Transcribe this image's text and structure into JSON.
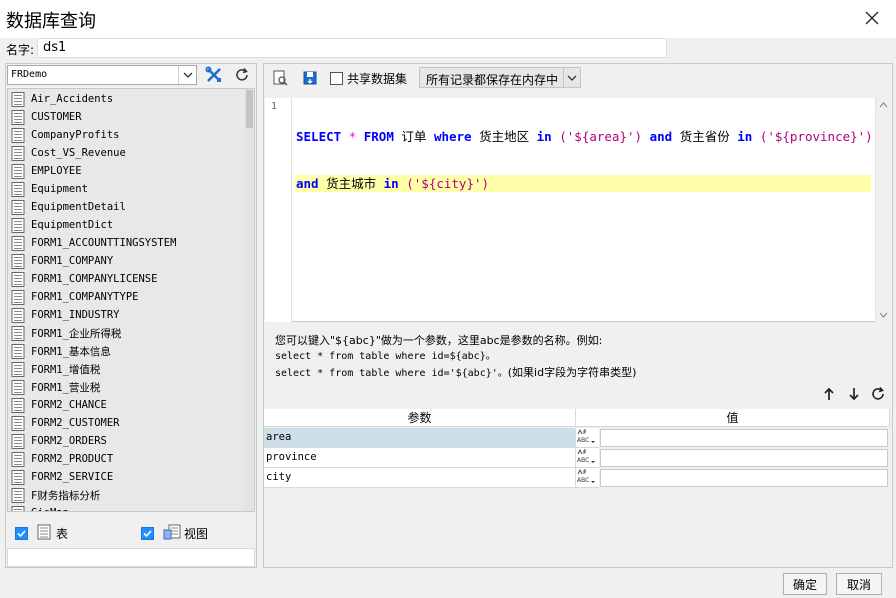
{
  "window": {
    "title": "数据库查询"
  },
  "name_field": {
    "label": "名字:",
    "value": "ds1"
  },
  "left": {
    "connection": "FRDemo",
    "tables": [
      "Air_Accidents",
      "CUSTOMER",
      "CompanyProfits",
      "Cost_VS_Revenue",
      "EMPLOYEE",
      "Equipment",
      "EquipmentDetail",
      "EquipmentDict",
      "FORM1_ACCOUNTTINGSYSTEM",
      "FORM1_COMPANY",
      "FORM1_COMPANYLICENSE",
      "FORM1_COMPANYTYPE",
      "FORM1_INDUSTRY",
      "FORM1_企业所得税",
      "FORM1_基本信息",
      "FORM1_增值税",
      "FORM1_营业税",
      "FORM2_CHANCE",
      "FORM2_CUSTOMER",
      "FORM2_ORDERS",
      "FORM2_PRODUCT",
      "FORM2_SERVICE",
      "F财务指标分析",
      "GisMap"
    ],
    "filter_table_label": "表",
    "filter_view_label": "视图"
  },
  "right": {
    "share_label": "共享数据集",
    "mode": "所有记录都保存在内存中",
    "line_number": "1",
    "sql": {
      "l1_kw1": "SELECT",
      "l1_star": "*",
      "l1_kw2": "FROM",
      "l1_t1": "订单",
      "l1_kw3": "where",
      "l1_t2": "货主地区",
      "l1_kw4": "in",
      "l1_s1": "('${area}')",
      "l1_kw5": "and",
      "l1_t3": "货主省份",
      "l1_kw6": "in",
      "l1_s2": "('${province}')",
      "l2_kw1": "and",
      "l2_t1": "货主城市",
      "l2_kw2": "in",
      "l2_s1": "('${city}')"
    },
    "hint": {
      "line1": "您可以键入\"${abc}\"做为一个参数，这里abc是参数的名称。例如:",
      "line2": "select * from table where id=${abc}。",
      "line3a": "select * from table where id='${abc}'。",
      "line3b": "(如果id字段为字符串类型)"
    },
    "params": {
      "col_name": "参数",
      "col_value": "值",
      "rows": [
        {
          "name": "area",
          "value": ""
        },
        {
          "name": "province",
          "value": ""
        },
        {
          "name": "city",
          "value": ""
        }
      ]
    }
  },
  "buttons": {
    "ok": "确定",
    "cancel": "取消"
  }
}
